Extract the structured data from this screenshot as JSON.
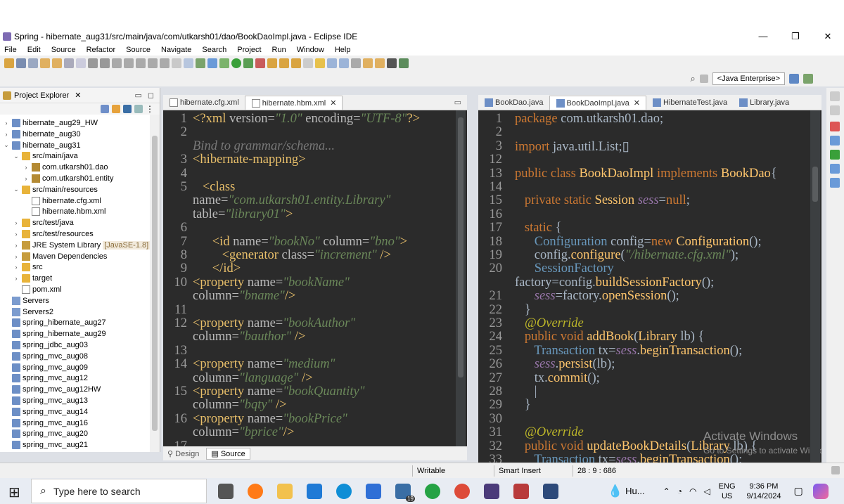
{
  "window": {
    "title": "Spring - hibernate_aug31/src/main/java/com/utkarsh01/dao/BookDaoImpl.java - Eclipse IDE",
    "controls": [
      "—",
      "❐",
      "✕"
    ]
  },
  "menu": [
    "File",
    "Edit",
    "Source",
    "Refactor",
    "Source",
    "Navigate",
    "Search",
    "Project",
    "Run",
    "Window",
    "Help"
  ],
  "perspective": "<Java Enterprise>",
  "explorer": {
    "title": "Project Explorer",
    "items": [
      {
        "label": "hibernate_aug29_HW",
        "icon": "project-icon",
        "twisty": "›"
      },
      {
        "label": "hibernate_aug30",
        "icon": "project-icon",
        "twisty": "›"
      },
      {
        "label": "hibernate_aug31",
        "icon": "project-icon",
        "twisty": "⌄"
      },
      {
        "label": "src/main/java",
        "icon": "source-folder-icon",
        "twisty": "⌄"
      },
      {
        "label": "com.utkarsh01.dao",
        "icon": "package-icon",
        "twisty": "›"
      },
      {
        "label": "com.utkarsh01.entity",
        "icon": "package-icon",
        "twisty": "›"
      },
      {
        "label": "src/main/resources",
        "icon": "source-folder-icon",
        "twisty": "⌄"
      },
      {
        "label": "hibernate.cfg.xml",
        "icon": "xml-file-icon",
        "twisty": ""
      },
      {
        "label": "hibernate.hbm.xml",
        "icon": "xml-file-icon",
        "twisty": ""
      },
      {
        "label": "src/test/java",
        "icon": "source-folder-icon",
        "twisty": "›"
      },
      {
        "label": "src/test/resources",
        "icon": "source-folder-icon",
        "twisty": "›"
      },
      {
        "label": "JRE System Library",
        "icon": "library-icon",
        "twisty": "›",
        "decoration": "[JavaSE-1.8]"
      },
      {
        "label": "Maven Dependencies",
        "icon": "library-icon",
        "twisty": "›"
      },
      {
        "label": "src",
        "icon": "folder-icon",
        "twisty": "›"
      },
      {
        "label": "target",
        "icon": "folder-icon",
        "twisty": "›"
      },
      {
        "label": "pom.xml",
        "icon": "xml-file-icon",
        "twisty": ""
      },
      {
        "label": "Servers",
        "icon": "server-folder-icon",
        "twisty": ""
      },
      {
        "label": "Servers2",
        "icon": "server-folder-icon",
        "twisty": ""
      },
      {
        "label": "spring_hibernate_aug27",
        "icon": "project-icon",
        "twisty": ""
      },
      {
        "label": "spring_hibernate_aug29",
        "icon": "project-icon",
        "twisty": ""
      },
      {
        "label": "spring_jdbc_aug03",
        "icon": "project-icon",
        "twisty": ""
      },
      {
        "label": "spring_mvc_aug08",
        "icon": "project-icon",
        "twisty": ""
      },
      {
        "label": "spring_mvc_aug09",
        "icon": "project-icon",
        "twisty": ""
      },
      {
        "label": "spring_mvc_aug12",
        "icon": "project-icon",
        "twisty": ""
      },
      {
        "label": "spring_mvc_aug12HW",
        "icon": "project-icon",
        "twisty": ""
      },
      {
        "label": "spring_mvc_aug13",
        "icon": "project-icon",
        "twisty": ""
      },
      {
        "label": "spring_mvc_aug14",
        "icon": "project-icon",
        "twisty": ""
      },
      {
        "label": "spring_mvc_aug16",
        "icon": "project-icon",
        "twisty": ""
      },
      {
        "label": "spring_mvc_aug20",
        "icon": "project-icon",
        "twisty": ""
      },
      {
        "label": "spring_mvc_aug21",
        "icon": "project-icon",
        "twisty": ""
      }
    ]
  },
  "left_editor": {
    "tabs": [
      {
        "label": "hibernate.cfg.xml",
        "active": false
      },
      {
        "label": "hibernate.hbm.xml",
        "active": true
      }
    ],
    "hint": "Bind to grammar/schema...",
    "bottom_tabs": [
      "Design",
      "Source"
    ],
    "lines": [
      {
        "n": "1",
        "parts": [
          [
            "tg",
            "<?xml "
          ],
          [
            "an",
            "version="
          ],
          [
            "av",
            "\"1.0\""
          ],
          [
            "an",
            " encoding="
          ],
          [
            "av",
            "\"UTF-8\""
          ],
          [
            "tg",
            "?>"
          ]
        ]
      },
      {
        "n": "2",
        "parts": []
      },
      {
        "n": "",
        "parts": [
          [
            "hint",
            "Bind to grammar/schema..."
          ]
        ]
      },
      {
        "n": "3",
        "parts": [
          [
            "tg",
            "<hibernate-mapping>"
          ]
        ]
      },
      {
        "n": "4",
        "parts": []
      },
      {
        "n": "5",
        "parts": [
          [
            "tg",
            "   <class"
          ]
        ]
      },
      {
        "n": "",
        "parts": [
          [
            "an",
            "name="
          ],
          [
            "av",
            "\"com.utkarsh01.entity.Library\""
          ]
        ]
      },
      {
        "n": "",
        "parts": [
          [
            "an",
            "table="
          ],
          [
            "av",
            "\"library01\""
          ],
          [
            "tg",
            ">"
          ]
        ]
      },
      {
        "n": "6",
        "parts": []
      },
      {
        "n": "7",
        "parts": [
          [
            "tg",
            "      <id "
          ],
          [
            "an",
            "name="
          ],
          [
            "av",
            "\"bookNo\""
          ],
          [
            "an",
            " column="
          ],
          [
            "av",
            "\"bno\""
          ],
          [
            "tg",
            ">"
          ]
        ]
      },
      {
        "n": "8",
        "parts": [
          [
            "tg",
            "         <generator "
          ],
          [
            "an",
            "class="
          ],
          [
            "av",
            "\"increment\""
          ],
          [
            "tg",
            " />"
          ]
        ]
      },
      {
        "n": "9",
        "parts": [
          [
            "tg",
            "      </id>"
          ]
        ]
      },
      {
        "n": "10",
        "parts": [
          [
            "tg",
            "<property "
          ],
          [
            "an",
            "name="
          ],
          [
            "av",
            "\"bookName\""
          ]
        ]
      },
      {
        "n": "",
        "parts": [
          [
            "an",
            "column="
          ],
          [
            "av",
            "\"bname\""
          ],
          [
            "tg",
            "/>"
          ]
        ]
      },
      {
        "n": "11",
        "parts": []
      },
      {
        "n": "12",
        "parts": [
          [
            "tg",
            "<property "
          ],
          [
            "an",
            "name="
          ],
          [
            "av",
            "\"bookAuthor\""
          ]
        ]
      },
      {
        "n": "",
        "parts": [
          [
            "an",
            "column="
          ],
          [
            "av",
            "\"bauthor\""
          ],
          [
            "tg",
            " />"
          ]
        ]
      },
      {
        "n": "13",
        "parts": []
      },
      {
        "n": "14",
        "parts": [
          [
            "tg",
            "<property "
          ],
          [
            "an",
            "name="
          ],
          [
            "av",
            "\"medium\""
          ]
        ]
      },
      {
        "n": "",
        "parts": [
          [
            "an",
            "column="
          ],
          [
            "av",
            "\"language\""
          ],
          [
            "tg",
            " />"
          ]
        ]
      },
      {
        "n": "15",
        "parts": [
          [
            "tg",
            "<property "
          ],
          [
            "an",
            "name="
          ],
          [
            "av",
            "\"bookQuantity\""
          ]
        ]
      },
      {
        "n": "",
        "parts": [
          [
            "an",
            "column="
          ],
          [
            "av",
            "\"bqty\""
          ],
          [
            "tg",
            " />"
          ]
        ]
      },
      {
        "n": "16",
        "parts": [
          [
            "tg",
            "<property "
          ],
          [
            "an",
            "name="
          ],
          [
            "av",
            "\"bookPrice\""
          ]
        ]
      },
      {
        "n": "",
        "parts": [
          [
            "an",
            "column="
          ],
          [
            "av",
            "\"bprice\""
          ],
          [
            "tg",
            "/>"
          ]
        ]
      },
      {
        "n": "17",
        "parts": []
      }
    ]
  },
  "right_editor": {
    "tabs": [
      {
        "label": "BookDao.java",
        "active": false
      },
      {
        "label": "BookDaoImpl.java",
        "active": true
      },
      {
        "label": "HibernateTest.java",
        "active": false
      },
      {
        "label": "Library.java",
        "active": false
      }
    ],
    "lines": [
      {
        "n": "1",
        "parts": [
          [
            "kw",
            "package "
          ],
          [
            "pkgcol",
            "com.utkarsh01.dao;"
          ]
        ]
      },
      {
        "n": "2",
        "parts": []
      },
      {
        "n": "3",
        "parts": [
          [
            "kw",
            "import "
          ],
          [
            "pkgcol",
            "java.util.List;"
          ],
          [
            "pkgcol",
            "▯"
          ]
        ]
      },
      {
        "n": "12",
        "parts": []
      },
      {
        "n": "13",
        "parts": [
          [
            "kw",
            "public class "
          ],
          [
            "ty",
            "BookDaoImpl "
          ],
          [
            "kw",
            "implements "
          ],
          [
            "ty",
            "BookDao"
          ],
          [
            "pkgcol",
            "{"
          ]
        ]
      },
      {
        "n": "14",
        "parts": []
      },
      {
        "n": "15",
        "parts": [
          [
            "kw",
            "   private static "
          ],
          [
            "ty",
            "Session "
          ],
          [
            "fld",
            "sess"
          ],
          [
            "pkgcol",
            "="
          ],
          [
            "kw",
            "null"
          ],
          [
            "pkgcol",
            ";"
          ]
        ]
      },
      {
        "n": "16",
        "parts": []
      },
      {
        "n": "17",
        "parts": [
          [
            "kw",
            "   static "
          ],
          [
            "pkgcol",
            "{"
          ]
        ]
      },
      {
        "n": "18",
        "parts": [
          [
            "blue",
            "      Configuration "
          ],
          [
            "pkgcol",
            "config"
          ],
          [
            "pkgcol",
            "="
          ],
          [
            "kw",
            "new "
          ],
          [
            "ty",
            "Configuration"
          ],
          [
            "pkgcol",
            "();"
          ]
        ]
      },
      {
        "n": "19",
        "parts": [
          [
            "pkgcol",
            "      config."
          ],
          [
            "mt",
            "configure"
          ],
          [
            "pkgcol",
            "("
          ],
          [
            "av",
            "\"/hibernate.cfg.xml\""
          ],
          [
            "pkgcol",
            ");"
          ]
        ]
      },
      {
        "n": "20",
        "parts": [
          [
            "blue",
            "      SessionFactory"
          ]
        ]
      },
      {
        "n": "",
        "parts": [
          [
            "pkgcol",
            "factory=config."
          ],
          [
            "mt",
            "buildSessionFactory"
          ],
          [
            "pkgcol",
            "();"
          ]
        ]
      },
      {
        "n": "21",
        "parts": [
          [
            "fld",
            "      sess"
          ],
          [
            "pkgcol",
            "=factory."
          ],
          [
            "mt",
            "openSession"
          ],
          [
            "pkgcol",
            "();"
          ]
        ]
      },
      {
        "n": "22",
        "parts": [
          [
            "pkgcol",
            "   }"
          ]
        ]
      },
      {
        "n": "23",
        "parts": [
          [
            "ann",
            "   @Override"
          ]
        ]
      },
      {
        "n": "24",
        "parts": [
          [
            "kw",
            "   public void "
          ],
          [
            "mt",
            "addBook"
          ],
          [
            "pkgcol",
            "("
          ],
          [
            "ty",
            "Library "
          ],
          [
            "pkgcol",
            "lb) {"
          ]
        ]
      },
      {
        "n": "25",
        "parts": [
          [
            "blue",
            "      Transaction "
          ],
          [
            "pkgcol",
            "tx="
          ],
          [
            "fld",
            "sess"
          ],
          [
            "pkgcol",
            "."
          ],
          [
            "mt",
            "beginTransaction"
          ],
          [
            "pkgcol",
            "();"
          ]
        ]
      },
      {
        "n": "26",
        "parts": [
          [
            "fld",
            "      sess"
          ],
          [
            "pkgcol",
            "."
          ],
          [
            "mt",
            "persist"
          ],
          [
            "pkgcol",
            "(lb);"
          ]
        ]
      },
      {
        "n": "27",
        "parts": [
          [
            "pkgcol",
            "      tx."
          ],
          [
            "mt",
            "commit"
          ],
          [
            "pkgcol",
            "();"
          ]
        ]
      },
      {
        "n": "28",
        "parts": [
          [
            "pkgcol",
            "      |"
          ]
        ]
      },
      {
        "n": "29",
        "parts": [
          [
            "pkgcol",
            "   }"
          ]
        ]
      },
      {
        "n": "30",
        "parts": []
      },
      {
        "n": "31",
        "parts": [
          [
            "ann",
            "   @Override"
          ]
        ]
      },
      {
        "n": "32",
        "parts": [
          [
            "kw",
            "   public void "
          ],
          [
            "mt",
            "updateBookDetails"
          ],
          [
            "pkgcol",
            "("
          ],
          [
            "ty",
            "Library "
          ],
          [
            "pkgcol",
            "lb) {"
          ]
        ]
      },
      {
        "n": "33",
        "parts": [
          [
            "blue",
            "      Transaction "
          ],
          [
            "pkgcol",
            "tx="
          ],
          [
            "fld",
            "sess"
          ],
          [
            "pkgcol",
            "."
          ],
          [
            "mt",
            "beginTransaction"
          ],
          [
            "pkgcol",
            "();"
          ]
        ]
      }
    ]
  },
  "watermark": {
    "line1": "Activate Windows",
    "line2": "Go to Settings to activate Windows."
  },
  "status": {
    "writable": "Writable",
    "insert": "Smart Insert",
    "position": "28 : 9 : 686"
  },
  "taskbar": {
    "search_placeholder": "Type here to search",
    "weather": "Hu...",
    "lang": "ENG",
    "region": "US",
    "time": "9:36 PM",
    "date": "9/14/2024",
    "mail_badge": "19"
  },
  "colors": {
    "editor_bg": "#2b2b2b",
    "accent": "#3574f0"
  }
}
